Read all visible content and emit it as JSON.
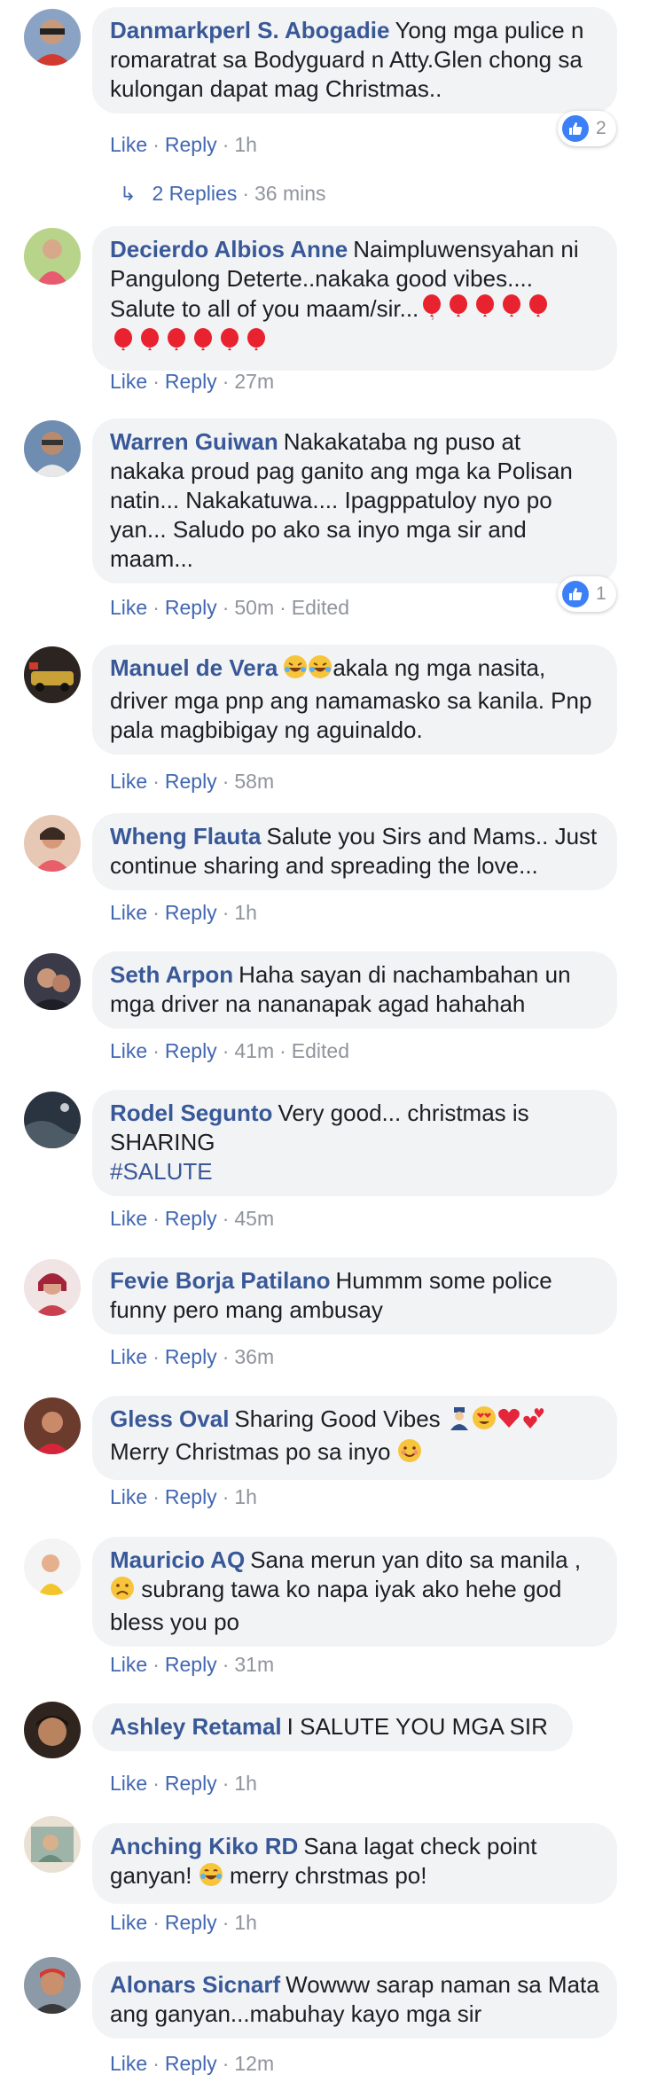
{
  "comments": [
    {
      "author": "Danmarkperl S. Abogadie",
      "body": "Yong mga pulice n romaratrat sa Bodyguard n Atty.Glen chong sa kulongan dapat mag Christmas..",
      "like": "Like",
      "reply": "Reply",
      "time": "1h",
      "reaction_count": "2",
      "replies_label": "2 Replies",
      "replies_time": "36 mins"
    },
    {
      "author": "Decierdo Albios Anne",
      "body": "Naimpluwensyahan ni Pangulong Deterte..nakaka good vibes.... Salute to all of you maam/sir...",
      "like": "Like",
      "reply": "Reply",
      "time": "27m"
    },
    {
      "author": "Warren Guiwan",
      "body": "Nakakataba ng puso at nakaka proud pag ganito ang mga ka Polisan natin... Nakakatuwa.... Ipagppatuloy nyo po yan... Saludo po ako sa inyo mga sir and maam...",
      "like": "Like",
      "reply": "Reply",
      "time": "50m",
      "edited": "Edited",
      "reaction_count": "1"
    },
    {
      "author": "Manuel de Vera",
      "body": "akala ng mga nasita, driver mga pnp ang namamasko sa kanila. Pnp pala magbibigay ng aguinaldo.",
      "like": "Like",
      "reply": "Reply",
      "time": "58m"
    },
    {
      "author": "Wheng Flauta",
      "body": "Salute you Sirs and Mams.. Just continue sharing and spreading the love...",
      "like": "Like",
      "reply": "Reply",
      "time": "1h"
    },
    {
      "author": "Seth Arpon",
      "body": "Haha sayan di nachambahan un mga driver na nananapak agad hahahah",
      "like": "Like",
      "reply": "Reply",
      "time": "41m",
      "edited": "Edited"
    },
    {
      "author": "Rodel Segunto",
      "body": "Very good... christmas is SHARING",
      "hashtag": "#SALUTE",
      "like": "Like",
      "reply": "Reply",
      "time": "45m"
    },
    {
      "author": "Fevie Borja Patilano",
      "body": "Hummm some police funny pero mang ambusay",
      "like": "Like",
      "reply": "Reply",
      "time": "36m"
    },
    {
      "author": "Gless Oval",
      "body": "Sharing Good Vibes",
      "body2": "Merry Christmas po sa inyo",
      "like": "Like",
      "reply": "Reply",
      "time": "1h"
    },
    {
      "author": "Mauricio AQ",
      "body": "Sana merun yan dito sa manila ,",
      "body2": "subrang tawa ko napa iyak ako hehe god bless you po",
      "like": "Like",
      "reply": "Reply",
      "time": "31m"
    },
    {
      "author": "Ashley Retamal",
      "body": "I SALUTE YOU MGA SIR",
      "like": "Like",
      "reply": "Reply",
      "time": "1h"
    },
    {
      "author": "Anching Kiko RD",
      "body": "Sana lagat check point ganyan!",
      "body2": "merry chrstmas po!",
      "like": "Like",
      "reply": "Reply",
      "time": "1h"
    },
    {
      "author": "Alonars Sicnarf",
      "body": "Wowww sarap naman sa Mata ang ganyan...mabuhay kayo mga sir",
      "like": "Like",
      "reply": "Reply",
      "time": "12m"
    }
  ],
  "colors": {
    "link": "#385898",
    "action": "#4267b2",
    "meta": "#90949c",
    "bubble": "#f2f3f5",
    "like_blue": "#3b80f7",
    "balloon": "#e8232f"
  }
}
